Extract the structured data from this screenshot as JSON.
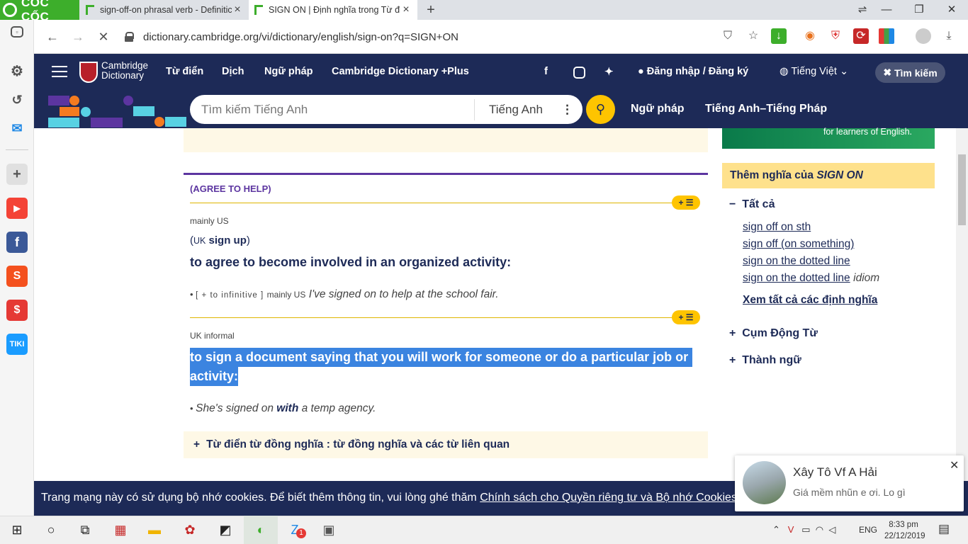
{
  "browser": {
    "brand": "CỐC CỐC",
    "tabs": [
      {
        "title": "sign-off-on phrasal verb - Definitic",
        "active": false
      },
      {
        "title": "SIGN ON | Định nghĩa trong Từ điể",
        "active": true
      }
    ],
    "url": "dictionary.cambridge.org/vi/dictionary/english/sign-on?q=SIGN+ON"
  },
  "sidebar_icons": [
    "settings-icon",
    "history-icon",
    "messenger-icon",
    "add-icon",
    "youtube-icon",
    "facebook-icon",
    "shopee-icon",
    "lazada-icon",
    "tiki-icon"
  ],
  "header": {
    "logo_line1": "Cambridge",
    "logo_line2": "Dictionary",
    "nav": [
      "Từ điển",
      "Dịch",
      "Ngữ pháp",
      "Cambridge Dictionary +Plus"
    ],
    "login": "Đăng nhập / Đăng ký",
    "language": "Tiếng Việt",
    "close_search": "Tìm kiếm"
  },
  "search": {
    "placeholder": "Tìm kiếm Tiếng Anh",
    "language": "Tiếng Anh",
    "links": [
      "Ngữ pháp",
      "Tiếng Anh–Tiếng Pháp"
    ]
  },
  "entry": {
    "guideword": "(AGREE TO HELP)",
    "sense1": {
      "region": "mainly US",
      "alt_open": "(",
      "alt_region": "UK",
      "alt_word": "sign up",
      "alt_close": ")",
      "definition": "to agree to become involved in an organized activity:",
      "example_grammar": "[ + to infinitive ]",
      "example_region": "mainly US",
      "example": "I've signed on to help at the school fair."
    },
    "sense2": {
      "region": "UK informal",
      "definition_line1": "to sign a document saying that you will work for someone or do a particular job or",
      "definition_line2": "activity:",
      "example_pre": "She's signed on ",
      "example_bold": "with",
      "example_post": " a temp agency."
    },
    "thesaurus": "Từ điển từ đồng nghĩa : từ đồng nghĩa và các từ liên quan"
  },
  "right": {
    "ad_text": "for learners of English.",
    "more_title": "Thêm nghĩa của",
    "more_word": "SIGN ON",
    "all_label": "Tất cả",
    "links": [
      "sign off on sth",
      "sign off (on something)",
      "sign on the dotted line",
      "sign on the dotted line"
    ],
    "idiom_label": "idiom",
    "see_all": "Xem tất cả các định nghĩa",
    "phrasal": "Cụm Động Từ",
    "idioms": "Thành ngữ"
  },
  "cookie": {
    "text": "Trang mạng này có sử dụng bộ nhớ cookies. Để biết thêm thông tin, vui lòng ghé thăm ",
    "link": "Chính sách cho Quyền riêng tư và Bộ nhớ Cookies"
  },
  "notification": {
    "title": "Xây Tô Vf A Hải",
    "body": "Giá mềm nhũn e ơi. Lo gì"
  },
  "taskbar": {
    "lang": "ENG",
    "time": "8:33 pm",
    "date": "22/12/2019",
    "zalo_badge": "1"
  },
  "colors": {
    "navy": "#1d2a57",
    "yellow": "#fec400",
    "purple": "#5c35a0",
    "selection": "#3b84e0"
  }
}
